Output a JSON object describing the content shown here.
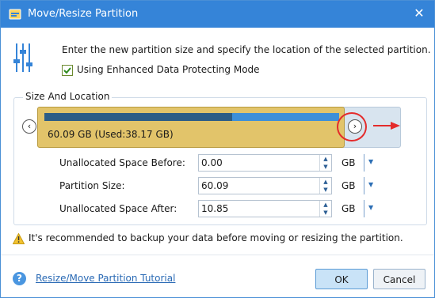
{
  "window": {
    "title": "Move/Resize Partition",
    "close_glyph": "✕",
    "title_icon": "move-resize-icon"
  },
  "intro": {
    "text": "Enter the new partition size and specify the location of the selected partition.",
    "icon": "sliders-icon"
  },
  "enhanced_mode": {
    "label": "Using Enhanced Data Protecting Mode",
    "checked": true
  },
  "size_location": {
    "label": "Size And Location",
    "partition_text": "60.09 GB (Used:38.17 GB)",
    "used_fraction": 0.636,
    "partition_color": "#e2c46a",
    "used_color": "#2c5d86",
    "free_color": "#3d8fd8",
    "nav_left_glyph": "‹",
    "nav_right_glyph": "›",
    "highlight_color": "#e42b2b"
  },
  "fields": [
    {
      "label": "Unallocated Space Before:",
      "value": "0.00",
      "unit": "GB"
    },
    {
      "label": "Partition Size:",
      "value": "60.09",
      "unit": "GB"
    },
    {
      "label": "Unallocated Space After:",
      "value": "10.85",
      "unit": "GB"
    }
  ],
  "warning": {
    "text": "It's recommended to backup your data before moving or resizing the partition.",
    "icon": "warning-icon"
  },
  "footer": {
    "help_glyph": "?",
    "help_link": "Resize/Move Partition Tutorial",
    "ok_label": "OK",
    "cancel_label": "Cancel"
  },
  "colors": {
    "titlebar": "#3584d8",
    "accent": "#2a6ab5"
  }
}
